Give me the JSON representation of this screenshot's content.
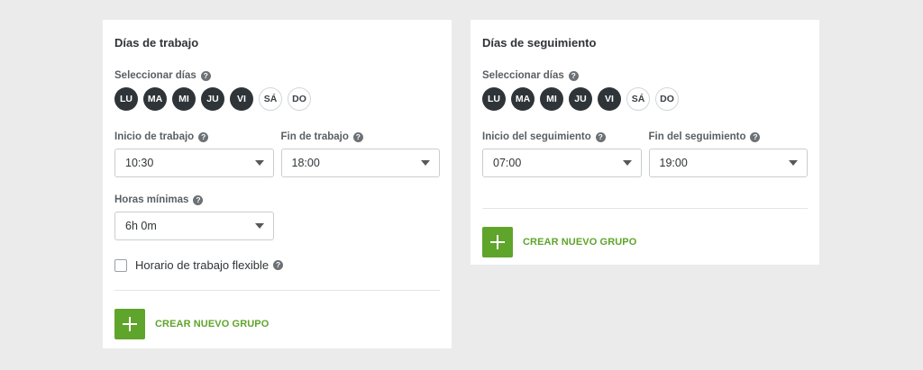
{
  "work": {
    "title": "Días de trabajo",
    "select_days_label": "Seleccionar días",
    "days": [
      {
        "label": "LU",
        "selected": true
      },
      {
        "label": "MA",
        "selected": true
      },
      {
        "label": "MI",
        "selected": true
      },
      {
        "label": "JU",
        "selected": true
      },
      {
        "label": "VI",
        "selected": true
      },
      {
        "label": "SÁ",
        "selected": false
      },
      {
        "label": "DO",
        "selected": false
      }
    ],
    "start_label": "Inicio de trabajo",
    "start_value": "10:30",
    "end_label": "Fin de trabajo",
    "end_value": "18:00",
    "min_hours_label": "Horas mínimas",
    "min_hours_value": "6h 0m",
    "flexible_label": "Horario de trabajo flexible",
    "flexible_checked": false,
    "create_group_label": "CREAR NUEVO GRUPO"
  },
  "tracking": {
    "title": "Días de seguimiento",
    "select_days_label": "Seleccionar días",
    "days": [
      {
        "label": "LU",
        "selected": true
      },
      {
        "label": "MA",
        "selected": true
      },
      {
        "label": "MI",
        "selected": true
      },
      {
        "label": "JU",
        "selected": true
      },
      {
        "label": "VI",
        "selected": true
      },
      {
        "label": "SÁ",
        "selected": false
      },
      {
        "label": "DO",
        "selected": false
      }
    ],
    "start_label": "Inicio del seguimiento",
    "start_value": "07:00",
    "end_label": "Fin del seguimiento",
    "end_value": "19:00",
    "create_group_label": "CREAR NUEVO GRUPO"
  },
  "help_glyph": "?",
  "colors": {
    "day_selected": "#2e3438",
    "accent_green": "#5fa42b",
    "background": "#ebebeb"
  },
  "icons": {
    "help": "question-circle-icon",
    "dropdown": "caret-down-icon",
    "add": "plus-icon"
  }
}
